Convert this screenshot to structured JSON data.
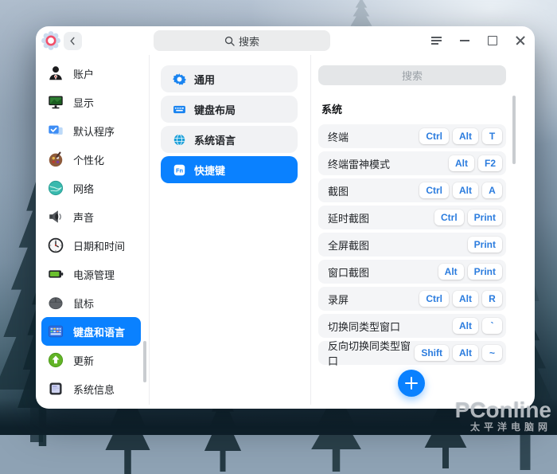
{
  "colors": {
    "accent": "#0a81ff",
    "key_text": "#2b7cde",
    "selected_bg": "#0a81ff"
  },
  "titlebar": {
    "search_placeholder": "搜索"
  },
  "sidebar": {
    "items": [
      {
        "id": "account",
        "label": "账户"
      },
      {
        "id": "display",
        "label": "显示"
      },
      {
        "id": "default-apps",
        "label": "默认程序"
      },
      {
        "id": "personalization",
        "label": "个性化"
      },
      {
        "id": "network",
        "label": "网络"
      },
      {
        "id": "sound",
        "label": "声音"
      },
      {
        "id": "datetime",
        "label": "日期和时间"
      },
      {
        "id": "power",
        "label": "电源管理"
      },
      {
        "id": "mouse",
        "label": "鼠标"
      },
      {
        "id": "keyboard",
        "label": "键盘和语言",
        "selected": true
      },
      {
        "id": "update",
        "label": "更新"
      },
      {
        "id": "sysinfo",
        "label": "系统信息"
      }
    ]
  },
  "subnav": {
    "items": [
      {
        "id": "general",
        "label": "通用"
      },
      {
        "id": "keyboard-layout",
        "label": "键盘布局"
      },
      {
        "id": "system-language",
        "label": "系统语言"
      },
      {
        "id": "shortcuts",
        "label": "快捷键",
        "selected": true
      }
    ]
  },
  "shortcuts": {
    "search_placeholder": "搜索",
    "section": "系统",
    "rows": [
      {
        "label": "终端",
        "keys": [
          "Ctrl",
          "Alt",
          "T"
        ]
      },
      {
        "label": "终端雷神模式",
        "keys": [
          "Alt",
          "F2"
        ]
      },
      {
        "label": "截图",
        "keys": [
          "Ctrl",
          "Alt",
          "A"
        ]
      },
      {
        "label": "延时截图",
        "keys": [
          "Ctrl",
          "Print"
        ]
      },
      {
        "label": "全屏截图",
        "keys": [
          "Print"
        ]
      },
      {
        "label": "窗口截图",
        "keys": [
          "Alt",
          "Print"
        ]
      },
      {
        "label": "录屏",
        "keys": [
          "Ctrl",
          "Alt",
          "R"
        ]
      },
      {
        "label": "切换同类型窗口",
        "keys": [
          "Alt",
          "`"
        ]
      },
      {
        "label": "反向切换同类型窗口",
        "keys": [
          "Shift",
          "Alt",
          "~"
        ]
      }
    ]
  },
  "watermark": {
    "line1": "PConline",
    "line2": "太平洋电脑网"
  }
}
